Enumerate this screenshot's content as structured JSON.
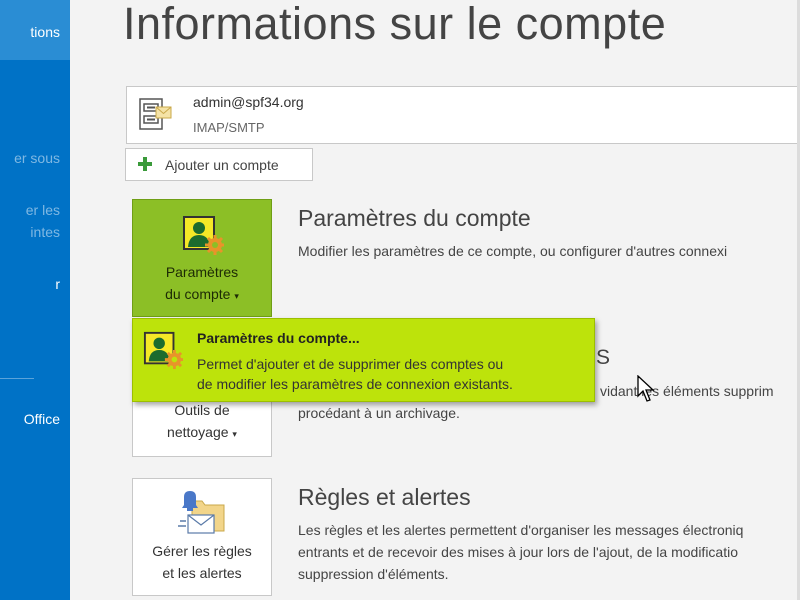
{
  "sidebar": {
    "items": [
      {
        "label": "tions",
        "active": true
      },
      {
        "label": "er sous"
      },
      {
        "label": "er les"
      },
      {
        "label": "intes"
      },
      {
        "label": "r"
      },
      {
        "label": "Office"
      }
    ]
  },
  "page": {
    "title": "Informations sur le compte"
  },
  "account": {
    "email": "admin@spf34.org",
    "type": "IMAP/SMTP",
    "icon": "account-envelope-icon"
  },
  "add_account": {
    "label": "Ajouter un compte",
    "icon": "green-plus-icon"
  },
  "sections": {
    "account_settings": {
      "tile_line1": "Paramètres",
      "tile_line2": "du compte",
      "title": "Paramètres du compte",
      "description": "Modifier les paramètres de ce compte, ou configurer d'autres connexi"
    },
    "cleanup": {
      "tile_line1": "Outils de",
      "tile_line2": "nettoyage",
      "title_visible_fragment": "S",
      "desc_line1": "vidant les éléments supprim",
      "desc_line2": "procédant à un archivage."
    },
    "rules": {
      "tile_line1": "Gérer les règles",
      "tile_line2": "et les alertes",
      "title": "Règles et alertes",
      "desc_line1": "Les règles et les alertes permettent d'organiser les messages électroniq",
      "desc_line2": "entrants et de recevoir des mises à jour lors de l'ajout, de la modificatio",
      "desc_line3": "suppression d'éléments."
    }
  },
  "popup": {
    "title": "Paramètres du compte...",
    "desc_line1": "Permet d'ajouter et de supprimer des comptes ou",
    "desc_line2": "de modifier les paramètres de connexion existants.",
    "icon": "account-settings-icon"
  },
  "colors": {
    "sidebar": "#0072c6",
    "tile_active": "#8cbf26",
    "popup": "#bde30b"
  }
}
